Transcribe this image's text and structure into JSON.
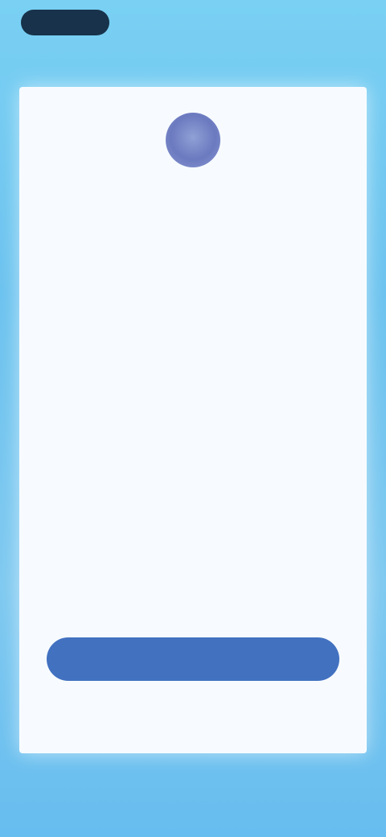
{
  "status_bar": {
    "pill_color": "#17324a"
  },
  "card": {
    "logo_icon": "app-logo",
    "title": "",
    "paragraphs": [
      "",
      ""
    ]
  },
  "actions": {
    "primary_label": "",
    "secondary_label": "",
    "tertiary_label": "",
    "accent_color": "#4271c0"
  }
}
